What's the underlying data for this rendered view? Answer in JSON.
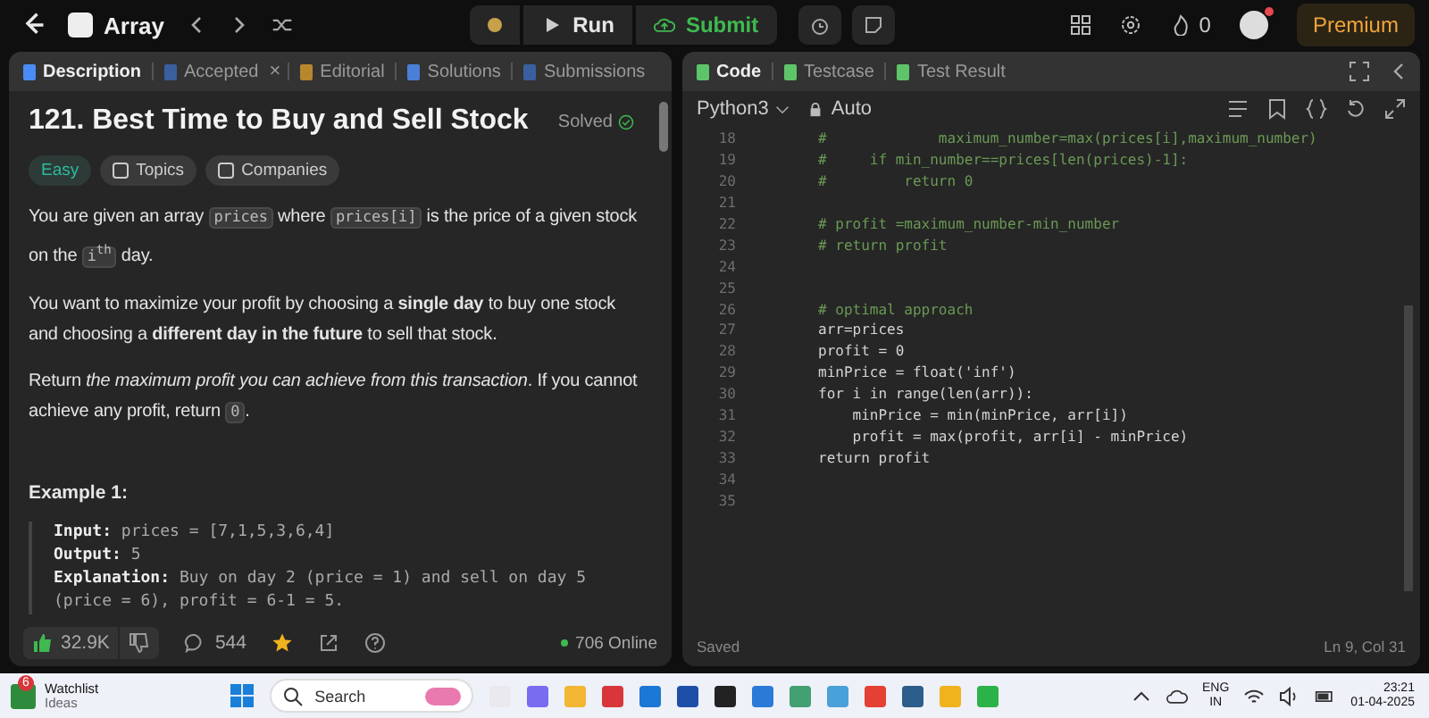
{
  "topbar": {
    "problem_list": "Array",
    "run": "Run",
    "submit": "Submit",
    "streak": "0",
    "premium": "Premium"
  },
  "left_tabs": [
    {
      "label": "Description",
      "selected": true
    },
    {
      "label": "Accepted",
      "selected": false,
      "close": "×"
    },
    {
      "label": "Editorial",
      "selected": false
    },
    {
      "label": "Solutions",
      "selected": false
    },
    {
      "label": "Submissions",
      "selected": false
    }
  ],
  "problem": {
    "title": "121. Best Time to Buy and Sell Stock",
    "status": "Solved",
    "difficulty": "Easy",
    "tags": [
      "Topics",
      "Companies"
    ],
    "paragraphs": [
      [
        {
          "kind": "text",
          "text": "You are given an array "
        },
        {
          "kind": "code",
          "text": "prices"
        },
        {
          "kind": "text",
          "text": " where "
        },
        {
          "kind": "code",
          "text": "prices[i]"
        },
        {
          "kind": "text",
          "text": " is the price of a given stock on the "
        },
        {
          "kind": "code",
          "text": "i$^{th}$"
        },
        {
          "kind": "text",
          "text": " day."
        }
      ],
      [
        {
          "kind": "text",
          "text": "You want to maximize your profit by choosing a **single day** to buy one stock and choosing a **different day in the future** to sell that stock."
        }
      ],
      [
        {
          "kind": "text",
          "text": "Return *the maximum profit you can achieve from this transaction*. If you cannot achieve any profit, return "
        },
        {
          "kind": "code",
          "text": "0"
        },
        {
          "kind": "text",
          "text": "."
        }
      ]
    ],
    "example_heading": "Example 1:",
    "example": [
      {
        "label": "Input:",
        "value": "prices = [7,1,5,3,6,4]"
      },
      {
        "label": "Output:",
        "value": "5"
      },
      {
        "label": "Explanation:",
        "value": "Buy on day 2 (price = 1) and sell on day 5 (price = 6), profit = 6-1 = 5."
      }
    ]
  },
  "footer": {
    "likes": "32.9K",
    "comments": "544",
    "online": "706 Online"
  },
  "right_tabs": [
    {
      "label": "Code",
      "selected": true
    },
    {
      "label": "Testcase",
      "selected": false
    },
    {
      "label": "Test Result",
      "selected": false
    }
  ],
  "editor": {
    "language": "Python3",
    "mode": "Auto",
    "lines": [
      {
        "number": "18",
        "kind": "comment",
        "text": "#             maximum_number=max(prices[i],maximum_number)"
      },
      {
        "number": "19",
        "kind": "comment",
        "text": "#     if min_number==prices[len(prices)-1]:"
      },
      {
        "number": "20",
        "kind": "comment",
        "text": "#         return 0"
      },
      {
        "number": "21"
      },
      {
        "number": "22",
        "kind": "comment",
        "text": "# profit =maximum_number-min_number"
      },
      {
        "number": "23",
        "kind": "comment",
        "text": "# return profit"
      },
      {
        "number": "24"
      },
      {
        "number": "25"
      },
      {
        "number": "26",
        "kind": "comment",
        "text": "# optimal approach"
      },
      {
        "number": "27",
        "kind": "code",
        "text": "arr=prices"
      },
      {
        "number": "28",
        "kind": "code",
        "text": "profit = 0"
      },
      {
        "number": "29",
        "kind": "code",
        "text": "minPrice = float('inf')"
      },
      {
        "number": "30",
        "kind": "code",
        "text": "for i in range(len(arr)):"
      },
      {
        "number": "31",
        "kind": "code",
        "text": "    minPrice = min(minPrice, arr[i])"
      },
      {
        "number": "32",
        "kind": "code",
        "text": "    profit = max(profit, arr[i] - minPrice)"
      },
      {
        "number": "33",
        "kind": "code",
        "text": "return profit"
      },
      {
        "number": "34"
      },
      {
        "number": "35"
      }
    ],
    "status": "Saved",
    "cursor": "Ln 9, Col 31"
  },
  "taskbar": {
    "badge": "6",
    "watchlist": "Watchlist",
    "sub": "Ideas",
    "search": "Search",
    "lang": "ENG",
    "region": "IN",
    "time": "23:21",
    "date": "01-04-2025"
  }
}
